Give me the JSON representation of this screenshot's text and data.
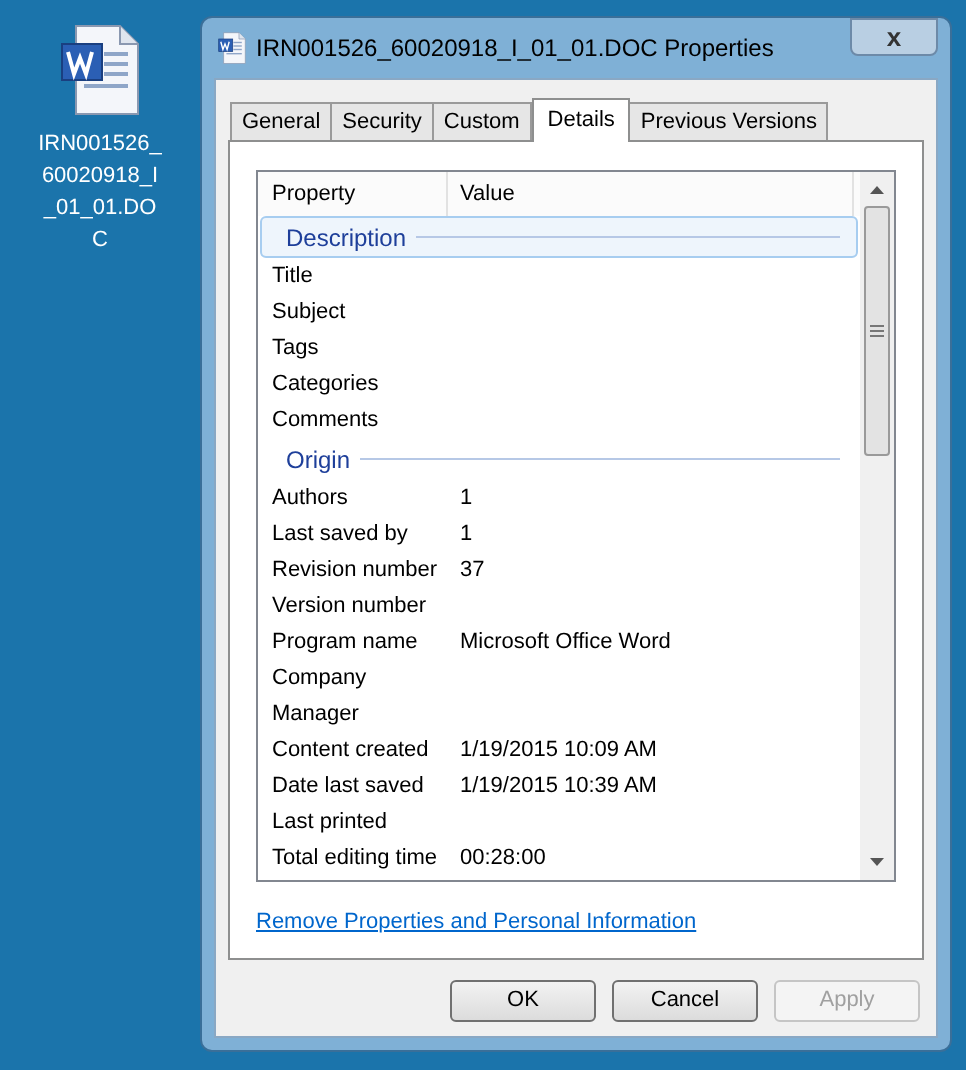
{
  "desktop_icon": {
    "label": "IRN001526_60020918_I_01_01.DOC"
  },
  "window": {
    "title": "IRN001526_60020918_I_01_01.DOC Properties",
    "close": "x"
  },
  "tabs": [
    {
      "label": "General",
      "selected": false
    },
    {
      "label": "Security",
      "selected": false
    },
    {
      "label": "Custom",
      "selected": false
    },
    {
      "label": "Details",
      "selected": true
    },
    {
      "label": "Previous Versions",
      "selected": false
    }
  ],
  "list": {
    "columns": [
      "Property",
      "Value"
    ],
    "rows": [
      {
        "kind": "group",
        "label": "Description",
        "selected": true
      },
      {
        "kind": "property",
        "name": "Title"
      },
      {
        "kind": "property",
        "name": "Subject"
      },
      {
        "kind": "property",
        "name": "Tags"
      },
      {
        "kind": "property",
        "name": "Categories"
      },
      {
        "kind": "property",
        "name": "Comments"
      },
      {
        "kind": "group",
        "label": "Origin",
        "selected": false
      },
      {
        "kind": "property",
        "name": "Authors",
        "value": "1"
      },
      {
        "kind": "property",
        "name": "Last saved by",
        "value": "1"
      },
      {
        "kind": "property",
        "name": "Revision number",
        "value": "37"
      },
      {
        "kind": "property",
        "name": "Version number"
      },
      {
        "kind": "property",
        "name": "Program name",
        "value": "Microsoft Office Word"
      },
      {
        "kind": "property",
        "name": "Company"
      },
      {
        "kind": "property",
        "name": "Manager"
      },
      {
        "kind": "property",
        "name": "Content created",
        "value": "1/19/2015 10:09 AM"
      },
      {
        "kind": "property",
        "name": "Date last saved",
        "value": "1/19/2015 10:39 AM"
      },
      {
        "kind": "property",
        "name": "Last printed"
      },
      {
        "kind": "property",
        "name": "Total editing time",
        "value": "00:28:00"
      }
    ]
  },
  "link": "Remove Properties and Personal Information",
  "buttons": [
    {
      "label": "OK",
      "disabled": false
    },
    {
      "label": "Cancel",
      "disabled": false
    },
    {
      "label": "Apply",
      "disabled": true
    }
  ]
}
